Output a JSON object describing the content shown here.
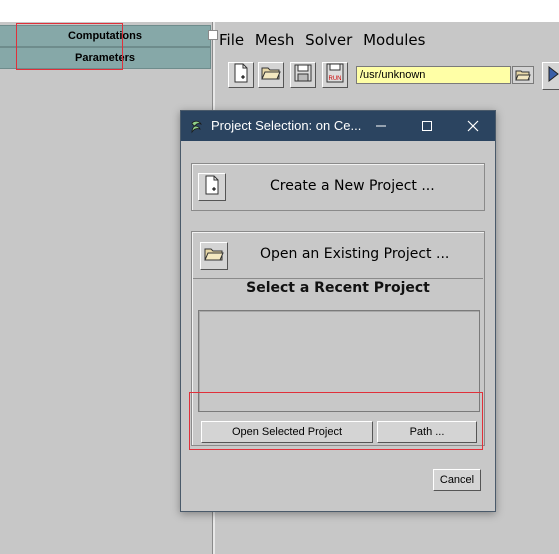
{
  "left_panel": {
    "buttons": [
      "Computations",
      "Parameters"
    ]
  },
  "main_window": {
    "menu": [
      "File",
      "Mesh",
      "Solver",
      "Modules"
    ],
    "toolbar": {
      "path_value": "/usr/unknown",
      "icons": [
        "new-project-icon",
        "open-folder-icon",
        "save-icon",
        "run-icon",
        "folder-browse-icon",
        "play-icon"
      ],
      "run_icon_text": "RUN"
    }
  },
  "dialog": {
    "title": "Project Selection: on Ce...",
    "controls": {
      "minimize": "─",
      "maximize": "☐",
      "close": "✕"
    },
    "create_label": "Create a New Project ...",
    "open_label": "Open an Existing Project ...",
    "recent_heading": "Select a Recent Project",
    "recent_items": [],
    "open_selected_label": "Open Selected Project",
    "path_label": "Path ...",
    "cancel_label": "Cancel"
  },
  "colors": {
    "left_button_bg": "#86a8a8",
    "titlebar_bg": "#2b4460",
    "path_field_bg": "#ffffa6",
    "highlight_border": "#e0303a"
  }
}
